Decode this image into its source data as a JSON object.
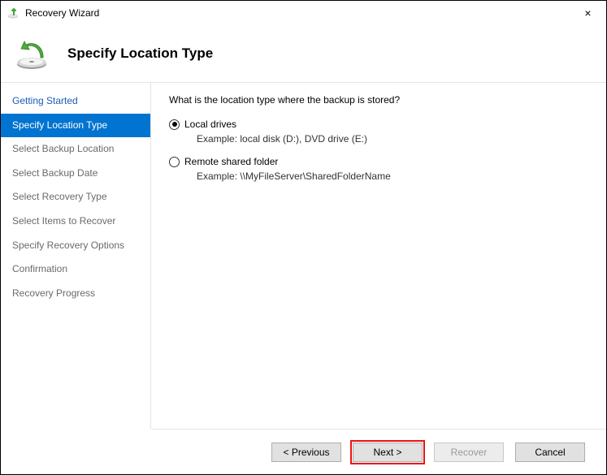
{
  "window": {
    "title": "Recovery Wizard",
    "close_label": "×"
  },
  "header": {
    "title": "Specify Location Type"
  },
  "sidebar": {
    "steps": [
      {
        "label": "Getting Started",
        "state": "done"
      },
      {
        "label": "Specify Location Type",
        "state": "current"
      },
      {
        "label": "Select Backup Location",
        "state": "pending"
      },
      {
        "label": "Select Backup Date",
        "state": "pending"
      },
      {
        "label": "Select Recovery Type",
        "state": "pending"
      },
      {
        "label": "Select Items to Recover",
        "state": "pending"
      },
      {
        "label": "Specify Recovery Options",
        "state": "pending"
      },
      {
        "label": "Confirmation",
        "state": "pending"
      },
      {
        "label": "Recovery Progress",
        "state": "pending"
      }
    ]
  },
  "main": {
    "prompt": "What is the location type where the backup is stored?",
    "options": [
      {
        "label": "Local drives",
        "example": "Example: local disk (D:), DVD drive (E:)",
        "checked": true
      },
      {
        "label": "Remote shared folder",
        "example": "Example: \\\\MyFileServer\\SharedFolderName",
        "checked": false
      }
    ]
  },
  "footer": {
    "previous": "< Previous",
    "next": "Next >",
    "recover": "Recover",
    "cancel": "Cancel"
  }
}
